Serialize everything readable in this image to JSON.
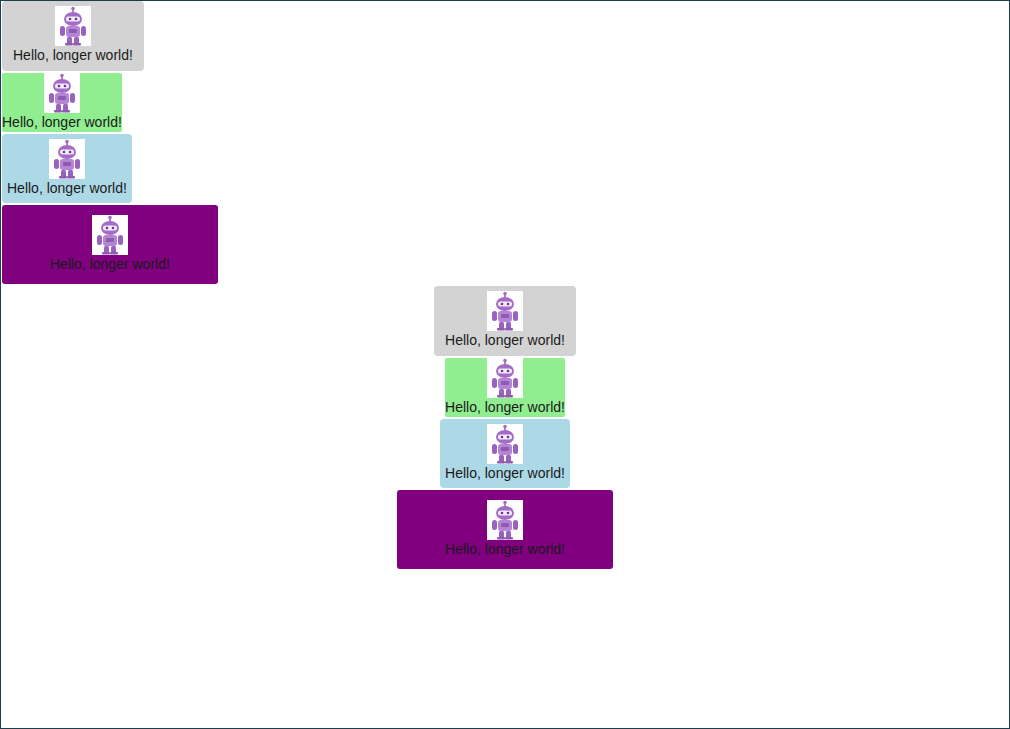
{
  "groups": [
    {
      "kind": "start",
      "cards": [
        {
          "text": "Hello, longer world!",
          "color": "#d3d3d3",
          "kind": "roomy"
        },
        {
          "text": "Hello, longer world!",
          "color": "#90ee90",
          "kind": "flush"
        },
        {
          "text": "Hello, longer world!",
          "color": "#add8e6",
          "kind": "snug"
        },
        {
          "text": "Hello, longer world!",
          "color": "#800080",
          "kind": "wide"
        }
      ]
    },
    {
      "kind": "center",
      "cards": [
        {
          "text": "Hello, longer world!",
          "color": "#d3d3d3",
          "kind": "roomy"
        },
        {
          "text": "Hello, longer world!",
          "color": "#90ee90",
          "kind": "flush"
        },
        {
          "text": "Hello, longer world!",
          "color": "#add8e6",
          "kind": "snug"
        },
        {
          "text": "Hello, longer world!",
          "color": "#800080",
          "kind": "wide"
        }
      ]
    }
  ]
}
